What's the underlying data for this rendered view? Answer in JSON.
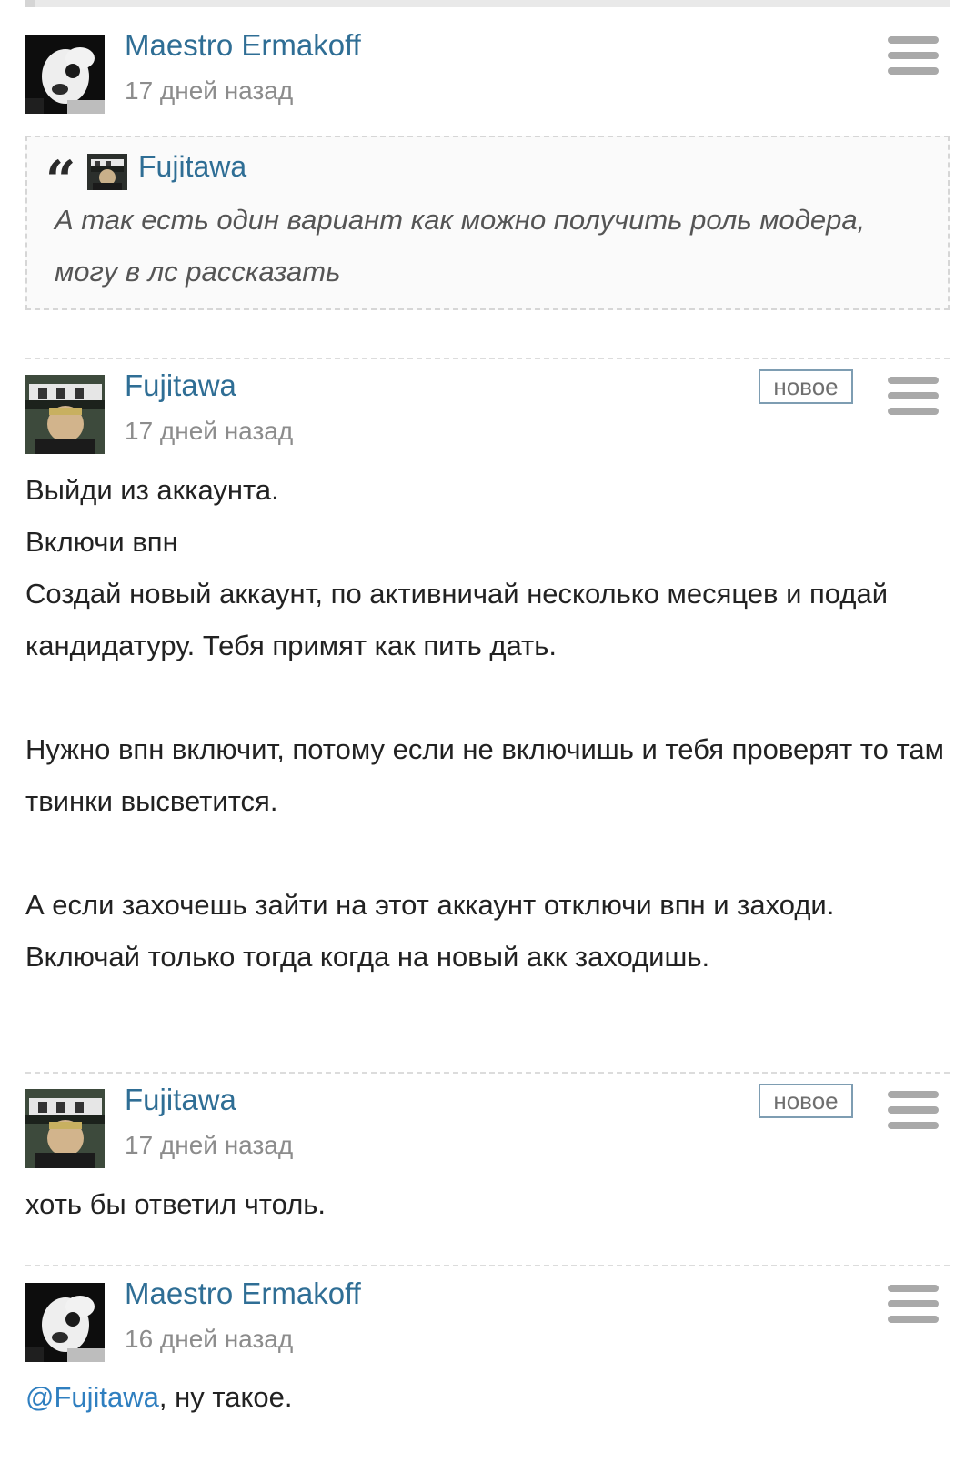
{
  "comments": [
    {
      "author": "Maestro Ermakoff",
      "time": "17 дней назад",
      "quote": {
        "author": "Fujitawa",
        "text": "А так есть один вариант как можно получить роль модера, могу в лс рассказать"
      }
    },
    {
      "author": "Fujitawa",
      "time": "17 дней назад",
      "badge": "новое",
      "paragraphs": [
        "Выйди из аккаунта.",
        "Включи впн",
        "Создай новый аккаунт, по активничай несколько месяцев и подай кандидатуру. Тебя примят как пить дать.",
        "Нужно впн включит, потому если не включишь и тебя проверят то там твинки высветится.",
        "А если захочешь зайти на этот аккаунт отключи впн и заходи. Включай только тогда когда на новый акк заходишь."
      ]
    },
    {
      "author": "Fujitawa",
      "time": "17 дней назад",
      "badge": "новое",
      "text": "хоть бы ответил чтоль."
    },
    {
      "author": "Maestro Ermakoff",
      "time": "16 дней назад",
      "mention": "@Fujitawa",
      "text_after_mention": ", ну такое."
    }
  ],
  "icons": {
    "menu": "hamburger-menu-icon",
    "quote": "quote-mark-icon"
  },
  "colors": {
    "author_link": "#2f6e95",
    "mention": "#2f7fc0",
    "badge_border": "#7e9db2",
    "menu_icon": "#a9a9a9"
  }
}
